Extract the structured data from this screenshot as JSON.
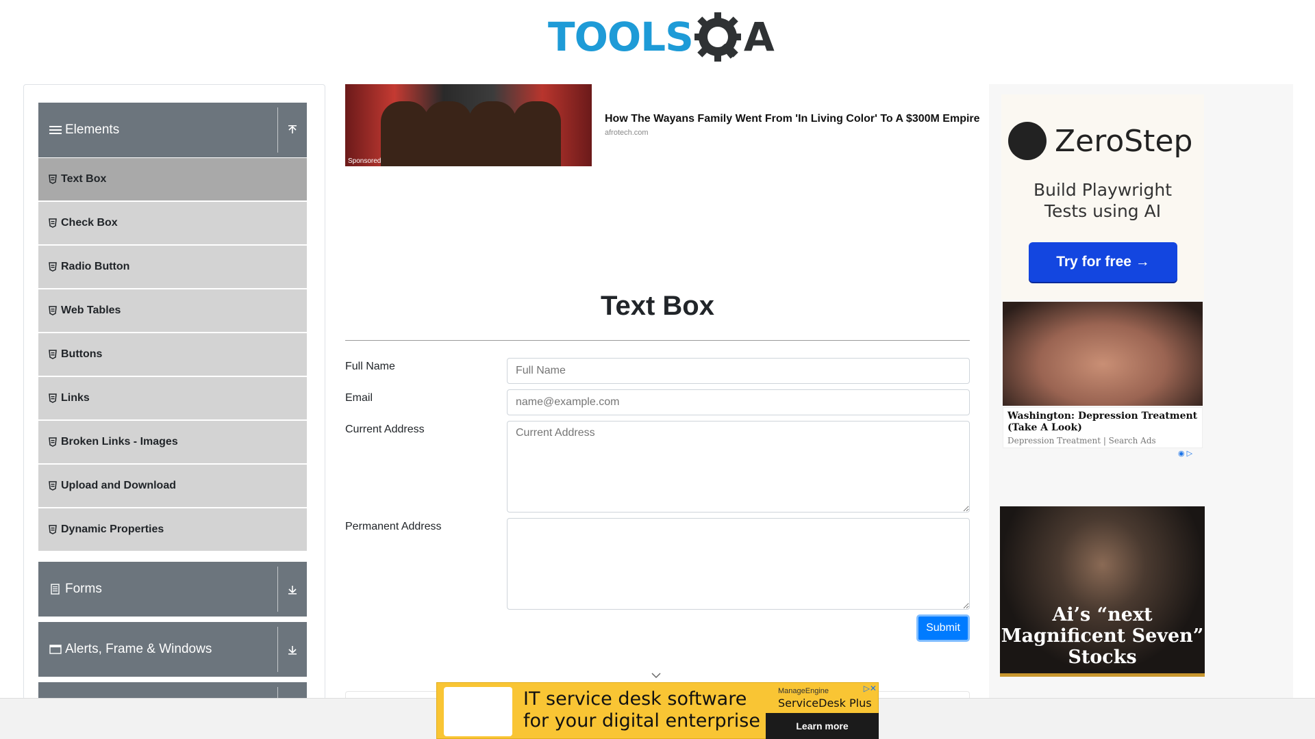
{
  "header": {
    "logo_text_left": "TOOLS",
    "logo_text_right": "A"
  },
  "sidebar": {
    "elements_group": {
      "label": "Elements",
      "items": [
        {
          "label": "Text Box",
          "active": true
        },
        {
          "label": "Check Box"
        },
        {
          "label": "Radio Button"
        },
        {
          "label": "Web Tables"
        },
        {
          "label": "Buttons"
        },
        {
          "label": "Links"
        },
        {
          "label": "Broken Links - Images"
        },
        {
          "label": "Upload and Download"
        },
        {
          "label": "Dynamic Properties"
        }
      ]
    },
    "forms_group": {
      "label": "Forms"
    },
    "alerts_group": {
      "label": "Alerts, Frame & Windows"
    }
  },
  "top_ad": {
    "sponsored": "Sponsored",
    "headline": "How The Wayans Family Went From 'In Living Color' To A $300M Empire",
    "source": "afrotech.com"
  },
  "form": {
    "title": "Text Box",
    "full_name_label": "Full Name",
    "full_name_placeholder": "Full Name",
    "email_label": "Email",
    "email_placeholder": "name@example.com",
    "current_address_label": "Current Address",
    "current_address_placeholder": "Current Address",
    "permanent_address_label": "Permanent Address",
    "submit_label": "Submit"
  },
  "right_ads": {
    "zerostep_brand": "ZeroStep",
    "zerostep_tagline_line1": "Build Playwright",
    "zerostep_tagline_line2": "Tests using AI",
    "zerostep_cta": "Try for free →",
    "face_headline": "Washington: Depression Treatment (Take A Look)",
    "face_source": "Depression Treatment | Search Ads",
    "stocks_line1": "Ai’s “next",
    "stocks_line2": "Magnificent Seven”",
    "stocks_line3": "Stocks"
  },
  "bottom_ad": {
    "line1": "IT service desk software",
    "line2": "for your digital enterprise",
    "brand_small": "ManageEngine",
    "brand_product": "ServiceDesk Plus",
    "cta": "Learn more"
  },
  "colors": {
    "brand_blue": "#1e9bd7",
    "group_header": "#6c757d",
    "menu_item": "#d3d3d3",
    "menu_item_active": "#a9a9a9",
    "submit": "#007bff",
    "zerostep_cta": "#1346e0",
    "bottom_ad_bg": "#f9c534"
  }
}
